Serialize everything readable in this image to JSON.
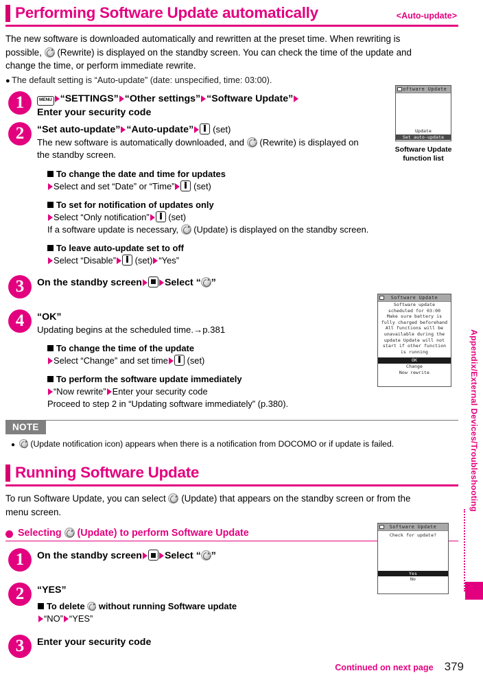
{
  "section1": {
    "title": "Performing Software Update automatically",
    "tag": "<Auto-update>",
    "intro_a": "The new software is downloaded automatically and rewritten at the preset time. When rewriting is",
    "intro_b": "possible,",
    "intro_c": "(Rewrite) is displayed on the standby screen. You can check the time of the update and",
    "intro_d": "change the time, or perform immediate rewrite.",
    "bullet1": "The default setting is “Auto-update” (date: unspecified, time: 03:00).",
    "steps": [
      {
        "num": "1",
        "key": "MENU",
        "t1": "“SETTINGS”",
        "t2": "“Other settings”",
        "t3": "“Software Update”",
        "t4": "Enter your security code"
      },
      {
        "num": "2",
        "t1": "“Set auto-update”",
        "t2": "“Auto-update”",
        "t3": "(set)",
        "sub_a": "The new software is automatically downloaded, and",
        "sub_b": "(Rewrite) is displayed on",
        "sub_c": "the standby screen.",
        "blocks": [
          {
            "head": "To change the date and time for updates",
            "line_a": "Select and set “Date” or “Time”",
            "line_b": "(set)"
          },
          {
            "head": "To set for notification of updates only",
            "line_a": "Select “Only notification”",
            "line_b": "(set)",
            "extra_a": "If a software update is necessary,",
            "extra_b": "(Update) is displayed on the standby screen."
          },
          {
            "head": "To leave auto-update set to off",
            "line_a": "Select “Disable”",
            "line_b": "(set)",
            "line_c": "“Yes”"
          }
        ]
      },
      {
        "num": "3",
        "t1": "On the standby screen",
        "t2": "Select “",
        "t3": "”"
      },
      {
        "num": "4",
        "t1": "“OK”",
        "sub_a": "Updating begins at the scheduled time.",
        "sub_ref": "→p.381",
        "blocks": [
          {
            "head": "To change the time of the update",
            "line_a": "Select “Change” and set time",
            "line_b": "(set)"
          },
          {
            "head": "To perform the software update immediately",
            "line_a": "“Now rewrite”",
            "line_b": "Enter your security code",
            "extra_a": "Proceed to step 2 in “Updating software immediately” (p.380)."
          }
        ]
      }
    ],
    "note": {
      "label": "NOTE",
      "text_a": "(Update notification icon) appears when there is a notification from DOCOMO or if update is failed."
    }
  },
  "section2": {
    "title": "Running Software Update",
    "intro_a": "To run Software Update, you can select",
    "intro_b": "(Update) that appears on the standby screen or from the",
    "intro_c": "menu screen.",
    "pink_head_a": "Selecting",
    "pink_head_b": "(Update) to perform Software Update",
    "steps": [
      {
        "num": "1",
        "t1": "On the standby screen",
        "t2": "Select “",
        "t3": "”"
      },
      {
        "num": "2",
        "t1": "“YES”",
        "blocks": [
          {
            "head_a": "To delete",
            "head_b": "without running Software update",
            "line_a": "“NO”",
            "line_b": "“YES”"
          }
        ]
      },
      {
        "num": "3",
        "t1": "Enter your security code"
      }
    ]
  },
  "mockups": {
    "funclist": {
      "title": "Software Update",
      "lines": [
        "Update"
      ],
      "selected": "Set auto-update",
      "caption_a": "Software Update",
      "caption_b": "function list"
    },
    "scheduled": {
      "title": "Software Update",
      "lines": [
        "Software update",
        "scheduled for 03:00",
        "Make sure battery is",
        "fully charged beforehand",
        "All functions will be",
        "unavailable during the",
        "update Update will not",
        "start if other function",
        "is running"
      ],
      "selected": "OK",
      "options": [
        "Change",
        "Now rewrite"
      ]
    },
    "checkupdate": {
      "title": "Software Update",
      "lines": [
        "Check for update?"
      ],
      "selected": "Yes",
      "options": [
        "No"
      ]
    }
  },
  "side_tab": "Appendix/External Devices/Troubleshooting",
  "footer": {
    "continued": "Continued on next page",
    "page": "379"
  },
  "colors": {
    "accent": "#e3007f",
    "note_grey": "#808080",
    "mock_title_grey": "#a9a9a9"
  }
}
